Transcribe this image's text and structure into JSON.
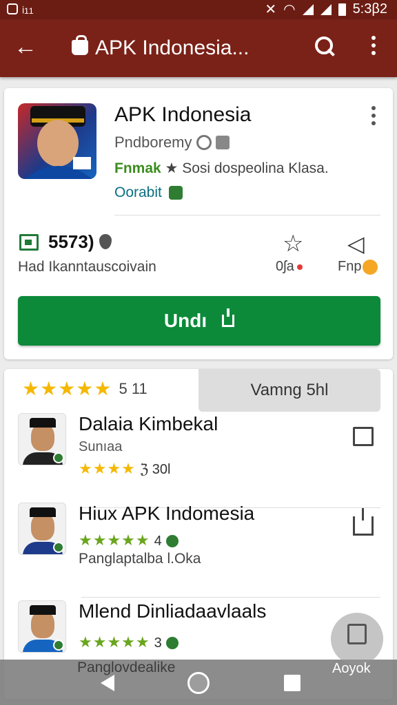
{
  "status_bar": {
    "left": "ᵢ₁₁",
    "time": "5:3β2"
  },
  "app_bar": {
    "title": "APK Indonesia..."
  },
  "app": {
    "name": "APK Indonesia",
    "developer": "Pndboremy",
    "tag": "Fnmak",
    "tag_suffix": "★ Sosi dospeolina Klasa.",
    "option": "Oorabit",
    "stat_value": "5573)",
    "stat_desc": "Had Ikanntauscoivain",
    "action1_label": "0ʃa",
    "action2_label": "Fnp",
    "install_label": "Undı"
  },
  "list": {
    "rating_stars": "★★★★★",
    "rating_value": "5 11",
    "tab_label": "Vamng 5hl",
    "items": [
      {
        "title": "Dalaia Kimbekal",
        "subtitle": "Sunıaa",
        "stars": "★★★★",
        "count": "ℨ 30l",
        "desc": ""
      },
      {
        "title": "Hiux APK Indomesia",
        "subtitle": "",
        "stars": "★★★★★",
        "count": "4",
        "desc": "Panglaptalba Ɩ.Oka"
      },
      {
        "title": "Mlend Dinliadaavlaals",
        "subtitle": "",
        "stars": "★★★★★",
        "count": "3",
        "desc": "Panglovdealike"
      }
    ]
  },
  "fab_label": "Aoyok"
}
